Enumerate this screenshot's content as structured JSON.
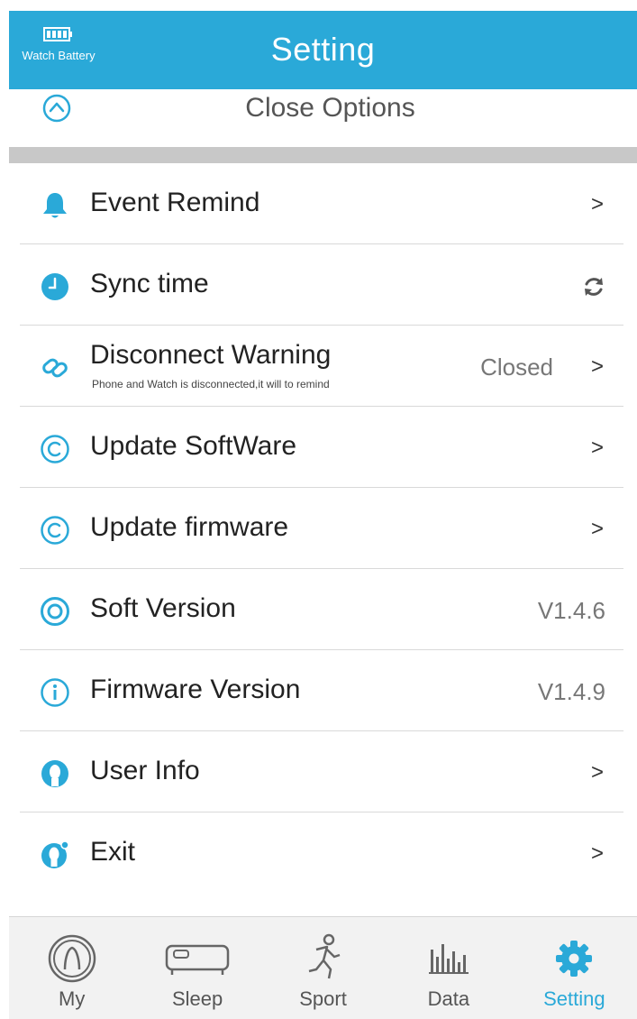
{
  "header": {
    "title": "Setting",
    "battery_label": "Watch Battery",
    "battery_icon": "battery-icon"
  },
  "close_options": {
    "label": "Close Options",
    "icon": "chevron-up-circle-icon"
  },
  "settings": [
    {
      "label": "Event Remind",
      "icon": "bell-icon",
      "trailing": ">"
    },
    {
      "label": "Sync time",
      "icon": "clock-icon",
      "trailing_icon": "sync-icon"
    },
    {
      "label": "Disconnect Warning",
      "sublabel": "Phone and Watch is disconnected,it will to remind",
      "icon": "link-icon",
      "value": "Closed",
      "trailing": ">"
    },
    {
      "label": "Update SoftWare",
      "icon": "copyright-icon",
      "trailing": ">"
    },
    {
      "label": "Update firmware",
      "icon": "copyright-icon",
      "trailing": ">"
    },
    {
      "label": "Soft Version",
      "icon": "target-icon",
      "value": "V1.4.6"
    },
    {
      "label": "Firmware Version",
      "icon": "info-icon",
      "value": "V1.4.9"
    },
    {
      "label": "User Info",
      "icon": "user-icon",
      "trailing": ">"
    },
    {
      "label": "Exit",
      "icon": "user-exit-icon",
      "trailing": ">"
    }
  ],
  "tabs": [
    {
      "label": "My",
      "icon": "profile-icon"
    },
    {
      "label": "Sleep",
      "icon": "bed-icon"
    },
    {
      "label": "Sport",
      "icon": "runner-icon"
    },
    {
      "label": "Data",
      "icon": "bar-chart-icon"
    },
    {
      "label": "Setting",
      "icon": "gear-icon",
      "active": true
    }
  ],
  "colors": {
    "accent": "#2aa9d8",
    "divider": "#d9d9d9",
    "band": "#c8c8c8"
  }
}
